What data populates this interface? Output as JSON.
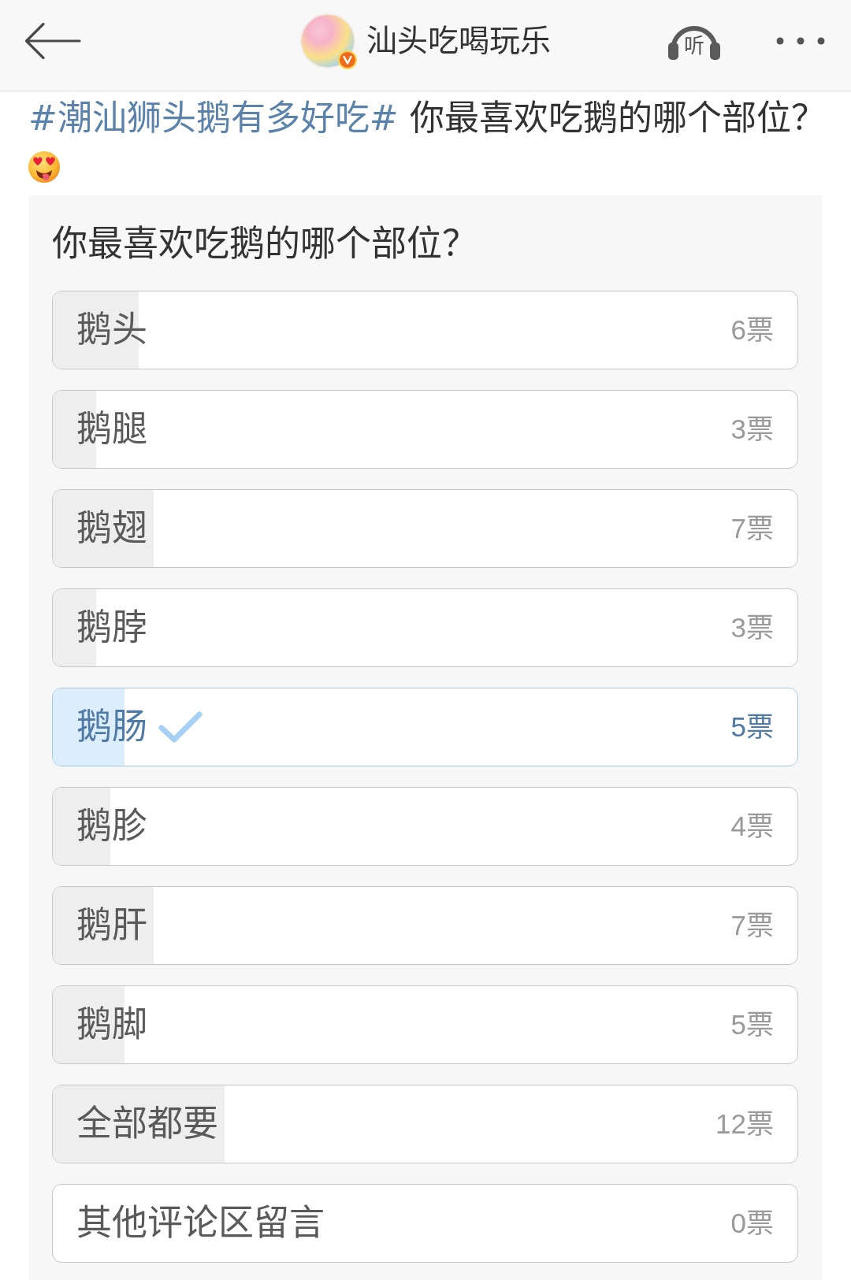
{
  "header": {
    "title": "汕头吃喝玩乐",
    "verified": true,
    "listen_label": "听"
  },
  "post": {
    "hashtag": "#潮汕狮头鹅有多好吃#",
    "text": "你最喜欢吃鹅的哪个部位？"
  },
  "poll": {
    "question": "你最喜欢吃鹅的哪个部位？",
    "options": [
      {
        "label": "鹅头",
        "votes": "6票",
        "level": 0.115,
        "selected": false
      },
      {
        "label": "鹅腿",
        "votes": "3票",
        "level": 0.058,
        "selected": false
      },
      {
        "label": "鹅翅",
        "votes": "7票",
        "level": 0.135,
        "selected": false
      },
      {
        "label": "鹅脖",
        "votes": "3票",
        "level": 0.058,
        "selected": false
      },
      {
        "label": "鹅肠",
        "votes": "5票",
        "level": 0.096,
        "selected": true
      },
      {
        "label": "鹅胗",
        "votes": "4票",
        "level": 0.077,
        "selected": false
      },
      {
        "label": "鹅肝",
        "votes": "7票",
        "level": 0.135,
        "selected": false
      },
      {
        "label": "鹅脚",
        "votes": "5票",
        "level": 0.096,
        "selected": false
      },
      {
        "label": "全部都要",
        "votes": "12票",
        "level": 0.231,
        "selected": false
      },
      {
        "label": "其他评论区留言",
        "votes": "0票",
        "level": 0,
        "selected": false
      }
    ]
  }
}
